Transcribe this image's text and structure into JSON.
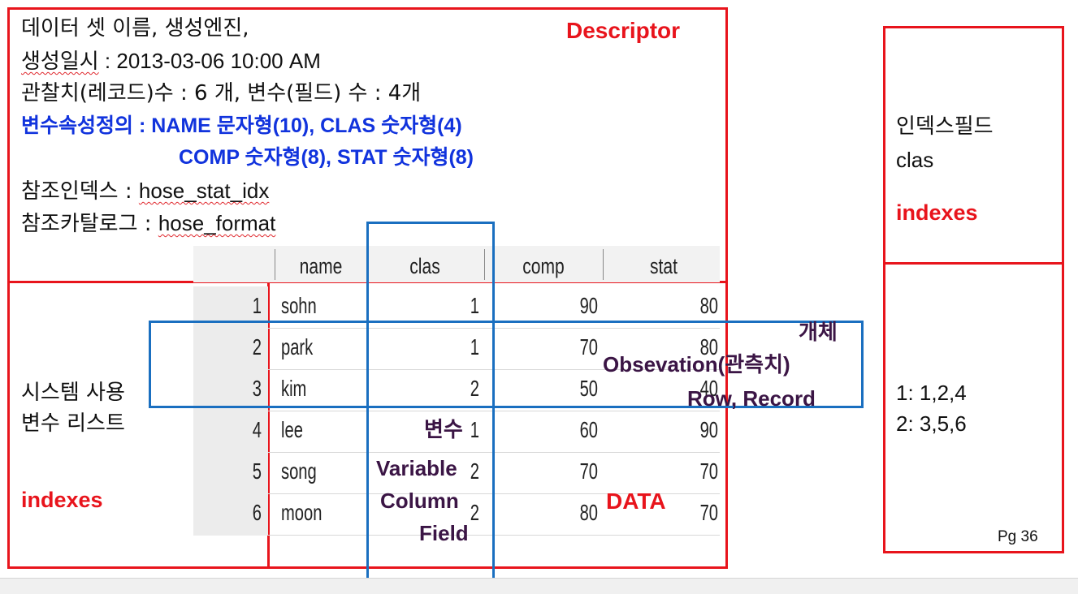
{
  "descriptor": {
    "label": "Descriptor",
    "line1": "데이터 셋 이름, 생성엔진,",
    "line2_prefix": "생성일시",
    "line2_value": " : 2013-03-06 10:00 AM",
    "line3": "관찰치(레코드)수 : 6 개,  변수(필드) 수 : 4개",
    "line4": "변수속성정의 :  NAME  문자형(10),  CLAS  숫자형(4)",
    "line5": "COMP  숫자형(8),   STAT   숫자형(8)",
    "line6_prefix": "참조인덱스 : ",
    "line6_value": "hose_stat_idx",
    "line7_prefix": "참조카탈로그 : ",
    "line7_value": "hose_format"
  },
  "table": {
    "columns": [
      "name",
      "clas",
      "comp",
      "stat"
    ],
    "rows": [
      {
        "n": "1",
        "name": "sohn",
        "clas": "1",
        "comp": "90",
        "stat": "80"
      },
      {
        "n": "2",
        "name": "park",
        "clas": "1",
        "comp": "70",
        "stat": "80"
      },
      {
        "n": "3",
        "name": "kim",
        "clas": "2",
        "comp": "50",
        "stat": "40"
      },
      {
        "n": "4",
        "name": "lee",
        "clas": "1",
        "comp": "60",
        "stat": "90"
      },
      {
        "n": "5",
        "name": "song",
        "clas": "2",
        "comp": "70",
        "stat": "70"
      },
      {
        "n": "6",
        "name": "moon",
        "clas": "2",
        "comp": "80",
        "stat": "70"
      }
    ]
  },
  "left_panel": {
    "line1": "시스템 사용",
    "line2": "변수 리스트",
    "indexes": "indexes"
  },
  "annotations": {
    "variable_kr": "변수",
    "variable_1": "Variable",
    "variable_2": "Column",
    "variable_3": "Field",
    "obs_kr": "개체",
    "obs_1": "Obsevation(관측치)",
    "obs_2": "Row, Record",
    "data": "DATA"
  },
  "right_panel": {
    "title1": "인덱스필드",
    "title2": "clas",
    "indexes": "indexes",
    "map1": "1: 1,2,4",
    "map2": "2: 3,5,6",
    "page": "Pg 36"
  },
  "colors": {
    "red": "#e8141c",
    "blue_box": "#1a6fc0",
    "blue_text": "#1133dd",
    "purple_text": "#3b1545"
  }
}
